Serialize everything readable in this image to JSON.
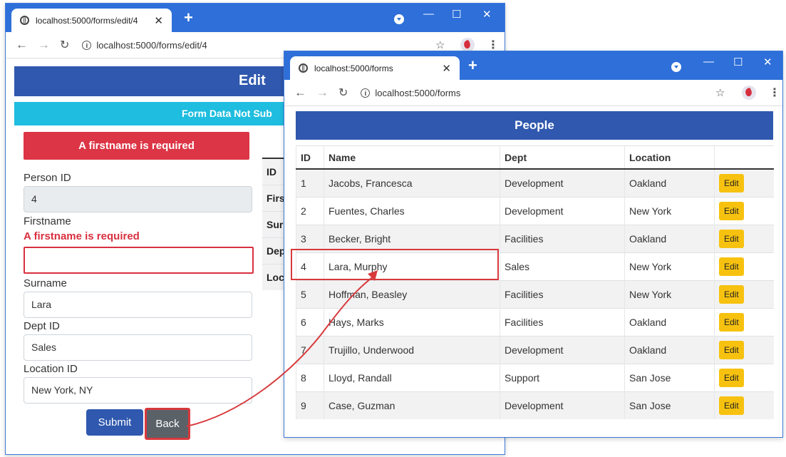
{
  "edit_window": {
    "tab_title": "localhost:5000/forms/edit/4",
    "url": "localhost:5000/forms/edit/4",
    "header": "Edit",
    "status_banner": "Form Data Not Sub",
    "summary_error": "A firstname is required",
    "fields": {
      "person_id": {
        "label": "Person ID",
        "value": "4"
      },
      "firstname": {
        "label": "Firstname",
        "error": "A firstname is required",
        "value": ""
      },
      "surname": {
        "label": "Surname",
        "value": "Lara"
      },
      "dept": {
        "label": "Dept ID",
        "value": "Sales"
      },
      "location": {
        "label": "Location ID",
        "value": "New York, NY"
      }
    },
    "submit_label": "Submit",
    "back_label": "Back",
    "side_table_labels": [
      "ID",
      "Firs",
      "Sur",
      "Dep",
      "Loc"
    ]
  },
  "people_window": {
    "tab_title": "localhost:5000/forms",
    "url": "localhost:5000/forms",
    "header": "People",
    "columns": [
      "ID",
      "Name",
      "Dept",
      "Location",
      ""
    ],
    "edit_label": "Edit",
    "rows": [
      {
        "id": "1",
        "name": "Jacobs, Francesca",
        "dept": "Development",
        "location": "Oakland"
      },
      {
        "id": "2",
        "name": "Fuentes, Charles",
        "dept": "Development",
        "location": "New York"
      },
      {
        "id": "3",
        "name": "Becker, Bright",
        "dept": "Facilities",
        "location": "Oakland"
      },
      {
        "id": "4",
        "name": "Lara, Murphy",
        "dept": "Sales",
        "location": "New York"
      },
      {
        "id": "5",
        "name": "Hoffman, Beasley",
        "dept": "Facilities",
        "location": "New York"
      },
      {
        "id": "6",
        "name": "Hays, Marks",
        "dept": "Facilities",
        "location": "Oakland"
      },
      {
        "id": "7",
        "name": "Trujillo, Underwood",
        "dept": "Development",
        "location": "Oakland"
      },
      {
        "id": "8",
        "name": "Lloyd, Randall",
        "dept": "Support",
        "location": "San Jose"
      },
      {
        "id": "9",
        "name": "Case, Guzman",
        "dept": "Development",
        "location": "San Jose"
      }
    ]
  },
  "colors": {
    "titlebar": "#2e6fd9",
    "primary": "#2f58ae",
    "info": "#1fbddf",
    "danger": "#dc3545",
    "warning": "#f7c20f",
    "secondary": "#5a6268",
    "annotation": "#d8393c"
  },
  "icons": [
    "globe-icon",
    "close-icon",
    "new-tab-icon",
    "minimize-icon",
    "maximize-icon",
    "window-close-icon",
    "back-icon",
    "forward-icon",
    "reload-icon",
    "info-icon",
    "star-icon",
    "profile-icon",
    "menu-icon"
  ]
}
